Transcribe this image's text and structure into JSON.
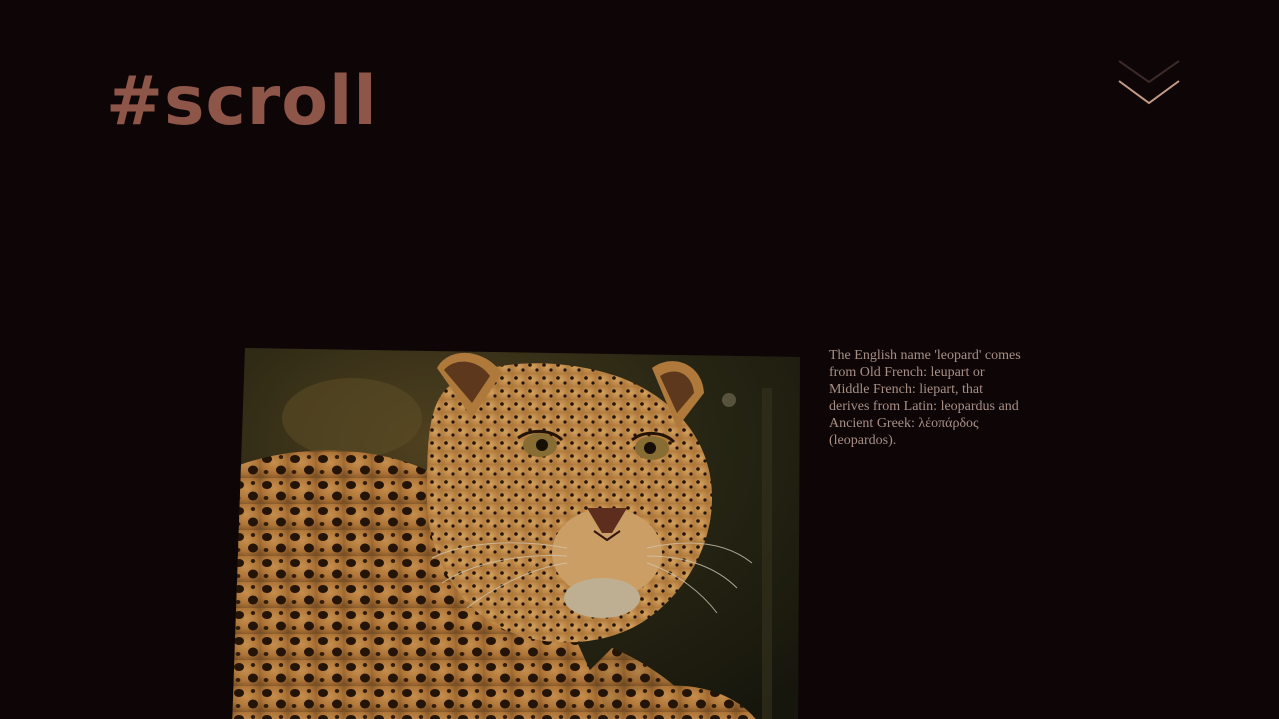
{
  "header": {
    "logo_text": "#scroll"
  },
  "controls": {
    "scroll_down_icon": "double-chevron-down-icon"
  },
  "article": {
    "image_subject": "leopard",
    "caption": "The English name 'leopard' comes from Old French: leupart or Middle French: liepart, that derives from Latin: leopardus and Ancient Greek: λέοπάρδος (leopardos)."
  },
  "colors": {
    "background": "#0e0606",
    "logo": "#8e5549",
    "chevron": "#c49a84",
    "caption_text": "#a88f86"
  }
}
